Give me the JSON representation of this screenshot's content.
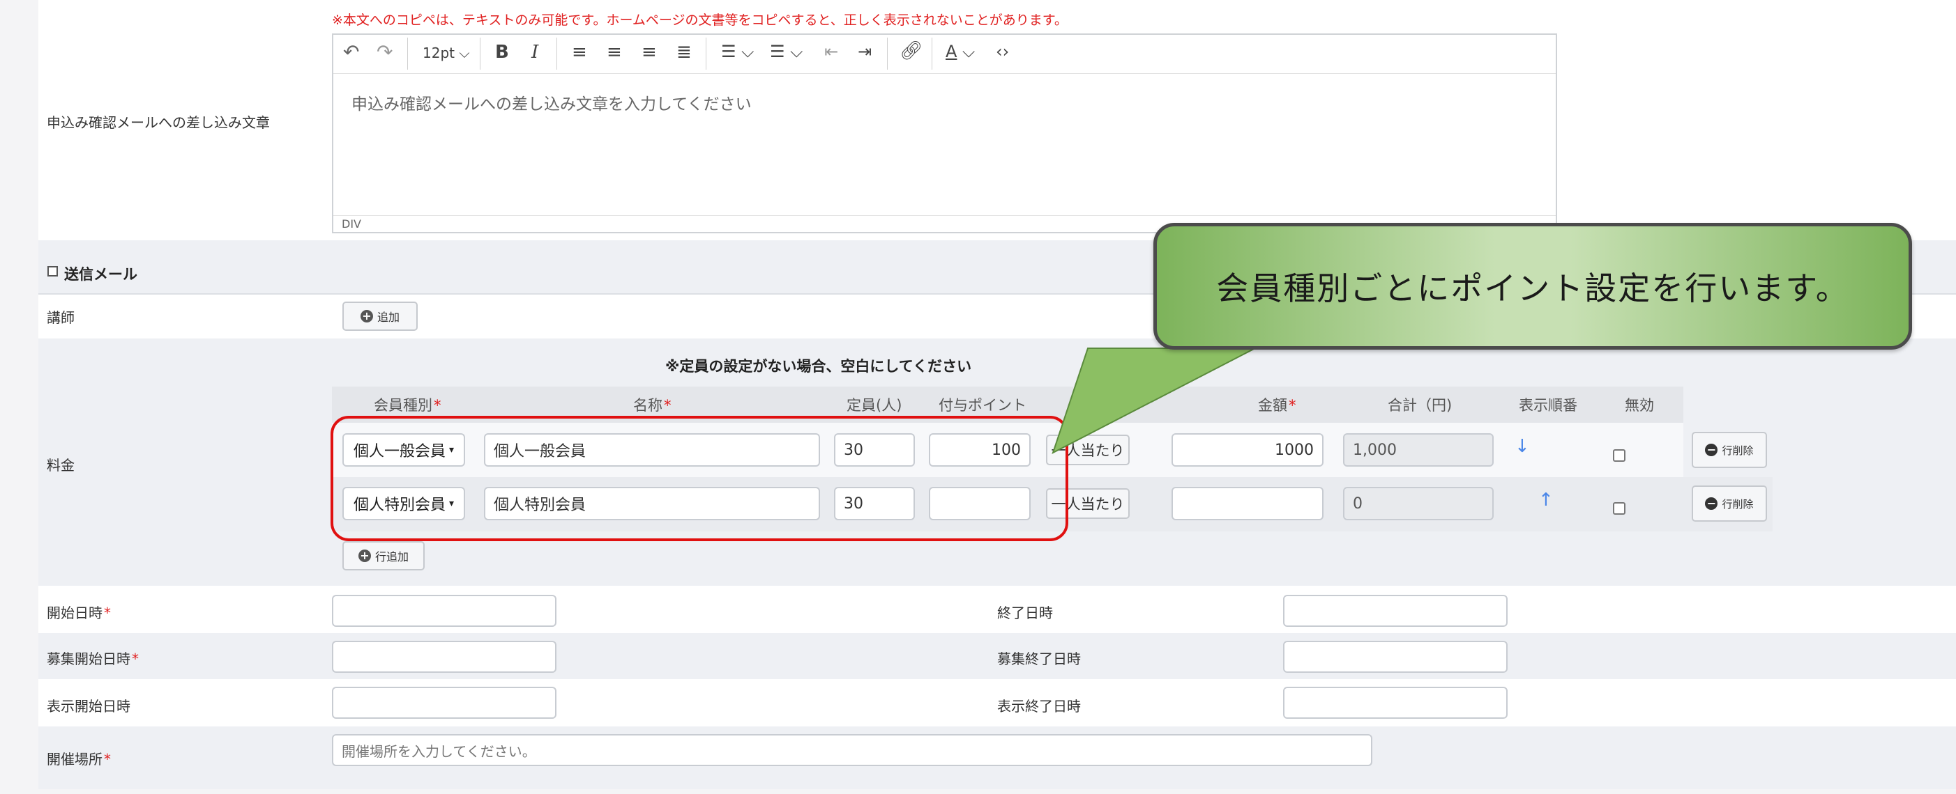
{
  "notice": "※本文へのコピペは、テキストのみ可能です。ホームページの文書等をコピペすると、正しく表示されないことがあります。",
  "editor": {
    "row_label": "申込み確認メールへの差し込み文章",
    "font_size": "12pt",
    "placeholder": "申込み確認メールへの差し込み文章を入力してください",
    "status": "DIV"
  },
  "sections": {
    "send_mail": "送信メール",
    "instructor_label": "講師",
    "add_label": "追加"
  },
  "fees": {
    "row_label": "料金",
    "note": "※定員の設定がない場合、空白にしてください",
    "headers": {
      "member_type": "会員種別",
      "name": "名称",
      "capacity": "定員(人)",
      "points": "付与ポイント",
      "amount": "金額",
      "total": "合計（円)",
      "order": "表示順番",
      "disable": "無効"
    },
    "rows": [
      {
        "member_type": "個人一般会員",
        "name": "個人一般会員",
        "capacity": "30",
        "points": "100",
        "per_person": "一人当たり",
        "amount": "1000",
        "total": "1,000",
        "order_arrow": "↓",
        "delete": "行削除"
      },
      {
        "member_type": "個人特別会員",
        "name": "個人特別会員",
        "capacity": "30",
        "points": "",
        "per_person": "一人当たり",
        "amount": "",
        "total": "0",
        "order_arrow": "↑",
        "delete": "行削除"
      }
    ],
    "add_row": "行追加"
  },
  "dates": {
    "start": "開始日時",
    "end": "終了日時",
    "recruit_start": "募集開始日時",
    "recruit_end": "募集終了日時",
    "display_start": "表示開始日時",
    "display_end": "表示終了日時"
  },
  "venue": {
    "label": "開催場所",
    "placeholder": "開催場所を入力してください。"
  },
  "callout": {
    "text": "会員種別ごとにポイント設定を行います。"
  },
  "colors": {
    "required": "#e02020",
    "highlight": "#e01010",
    "callout_green": "#7db35a",
    "arrow_blue": "#4a86e8"
  }
}
